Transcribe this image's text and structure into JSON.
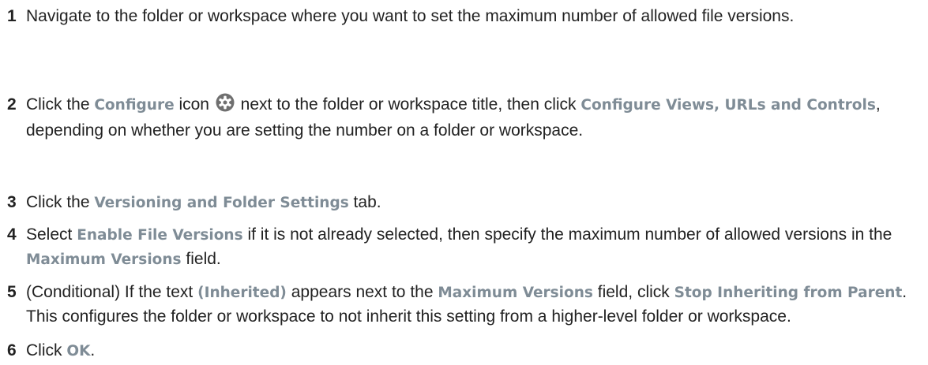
{
  "steps": [
    {
      "number": "1",
      "text": "Navigate to the folder or workspace where you want to set the maximum number of allowed file versions."
    },
    {
      "number": "2",
      "t1": "Click the ",
      "ui1": "Configure",
      "t2": " icon ",
      "t3": " next to the folder or workspace title, then click ",
      "ui2": "Configure Views, URLs and Controls",
      "t4": ", depending on whether you are setting the number on a folder or workspace."
    },
    {
      "number": "3",
      "t1": "Click the ",
      "ui1": "Versioning and Folder Settings",
      "t2": " tab."
    },
    {
      "number": "4",
      "t1": "Select ",
      "ui1": "Enable File Versions",
      "t2": " if it is not already selected, then specify the maximum number of allowed versions in the ",
      "ui2": "Maximum Versions",
      "t3": " field."
    },
    {
      "number": "5",
      "t1": "(Conditional) If the text ",
      "ui1": "(Inherited)",
      "t2": " appears next to the ",
      "ui2": "Maximum Versions",
      "t3": " field, click ",
      "ui3": "Stop Inheriting from Parent",
      "t4": ". This configures the folder or workspace to not inherit this setting from a higher-level folder or workspace."
    },
    {
      "number": "6",
      "t1": "Click ",
      "ui1": "OK",
      "t2": "."
    }
  ],
  "icons": {
    "configure": "gear-icon"
  },
  "colors": {
    "ui_label": "#7f8c96",
    "body_text": "#222222",
    "icon": "#6f6f6f"
  }
}
